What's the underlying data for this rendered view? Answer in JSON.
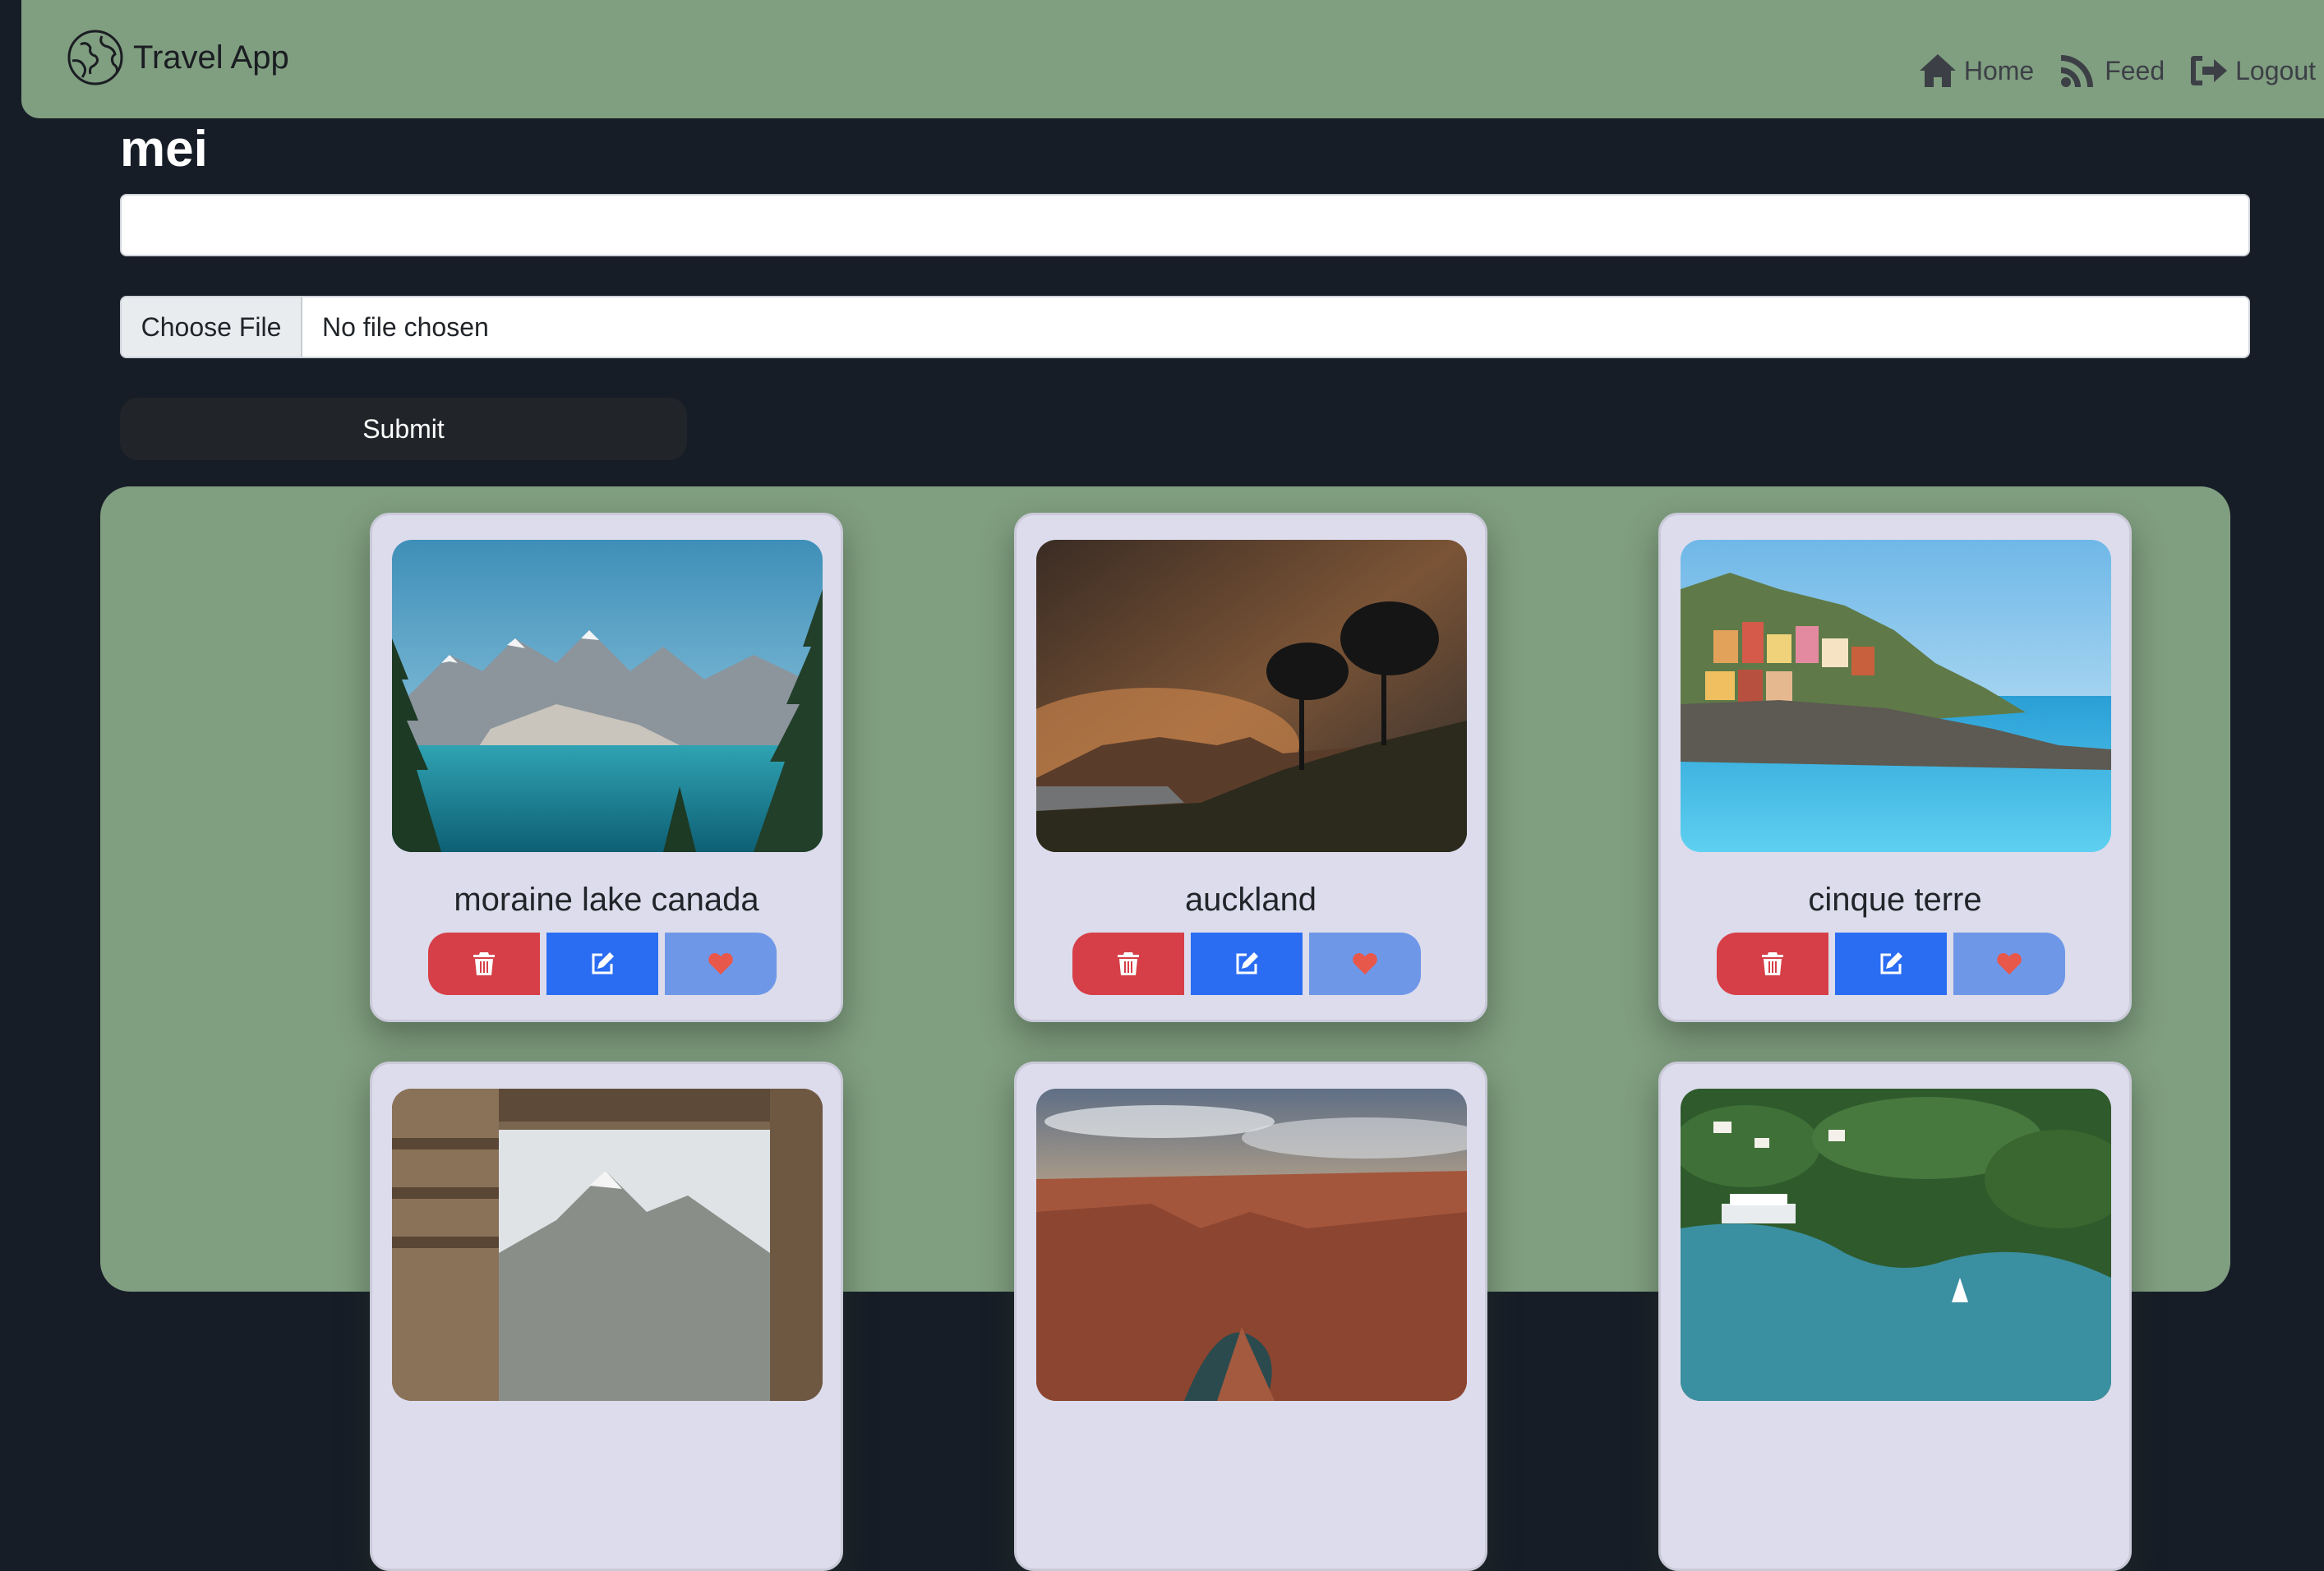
{
  "navbar": {
    "brand": "Travel App",
    "links": [
      {
        "label": "Home",
        "icon": "home-icon"
      },
      {
        "label": "Feed",
        "icon": "rss-icon"
      },
      {
        "label": "Logout",
        "icon": "logout-icon"
      }
    ]
  },
  "page": {
    "user_title": "mei"
  },
  "form": {
    "text_value": "",
    "text_placeholder": "",
    "file_button": "Choose File",
    "file_status": "No file chosen",
    "submit_label": "Submit"
  },
  "cards": [
    {
      "title": "moraine lake canada",
      "image": "mountain-lake-photo"
    },
    {
      "title": "auckland",
      "image": "sunset-hills-photo"
    },
    {
      "title": "cinque terre",
      "image": "coastal-village-photo"
    },
    {
      "title": "",
      "image": "stone-window-mountain-photo"
    },
    {
      "title": "",
      "image": "canyon-river-photo"
    },
    {
      "title": "",
      "image": "tropical-bay-photo"
    }
  ],
  "colors": {
    "navbar": "#809e80",
    "background": "#171d27",
    "delete": "#d63f47",
    "edit": "#2b6df2",
    "like": "#6f97e8",
    "heart": "#e8584a"
  }
}
